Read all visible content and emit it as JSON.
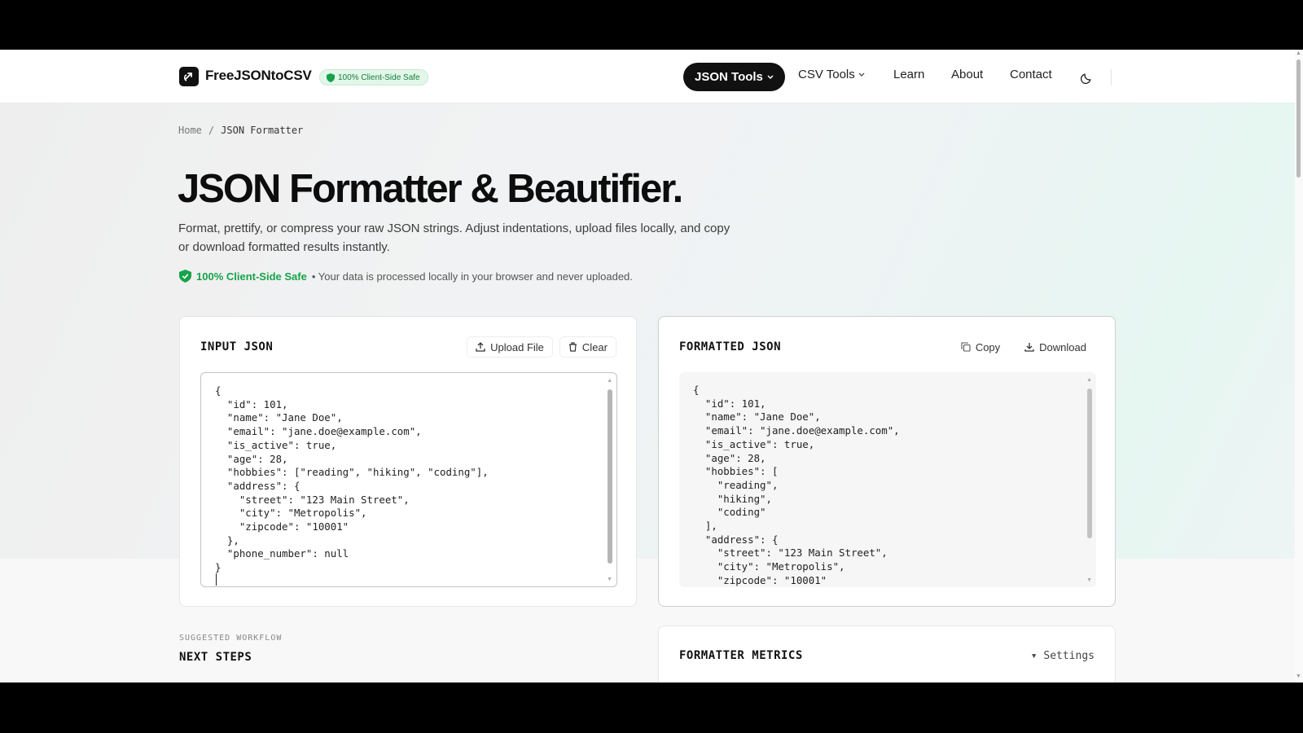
{
  "header": {
    "brand": "FreeJSONtoCSV",
    "safe_badge": "100% Client-Side Safe",
    "nav": {
      "json_tools": "JSON Tools",
      "csv_tools": "CSV Tools",
      "learn": "Learn",
      "about": "About",
      "contact": "Contact"
    }
  },
  "breadcrumb": {
    "home": "Home",
    "separator": "/",
    "current": "JSON Formatter"
  },
  "hero": {
    "title": "JSON Formatter & Beautifier.",
    "description": "Format, prettify, or compress your raw JSON strings. Adjust indentations, upload files locally, and copy or download formatted results instantly.",
    "safe_label": "100% Client-Side Safe",
    "safe_note": "• Your data is processed locally in your browser and never uploaded."
  },
  "input_card": {
    "title": "INPUT JSON",
    "upload_label": "Upload File",
    "clear_label": "Clear",
    "content": "{\n  \"id\": 101,\n  \"name\": \"Jane Doe\",\n  \"email\": \"jane.doe@example.com\",\n  \"is_active\": true,\n  \"age\": 28,\n  \"hobbies\": [\"reading\", \"hiking\", \"coding\"],\n  \"address\": {\n    \"street\": \"123 Main Street\",\n    \"city\": \"Metropolis\",\n    \"zipcode\": \"10001\"\n  },\n  \"phone_number\": null\n}"
  },
  "output_card": {
    "title": "FORMATTED JSON",
    "copy_label": "Copy",
    "download_label": "Download",
    "content": "{\n  \"id\": 101,\n  \"name\": \"Jane Doe\",\n  \"email\": \"jane.doe@example.com\",\n  \"is_active\": true,\n  \"age\": 28,\n  \"hobbies\": [\n    \"reading\",\n    \"hiking\",\n    \"coding\"\n  ],\n  \"address\": {\n    \"street\": \"123 Main Street\",\n    \"city\": \"Metropolis\",\n    \"zipcode\": \"10001\""
  },
  "workflow": {
    "label": "SUGGESTED WORKFLOW",
    "title": "NEXT STEPS"
  },
  "metrics": {
    "title": "FORMATTER METRICS",
    "settings_label": "▾ Settings"
  },
  "colors": {
    "accent_green": "#16a34a",
    "nav_active_bg": "#111111"
  }
}
